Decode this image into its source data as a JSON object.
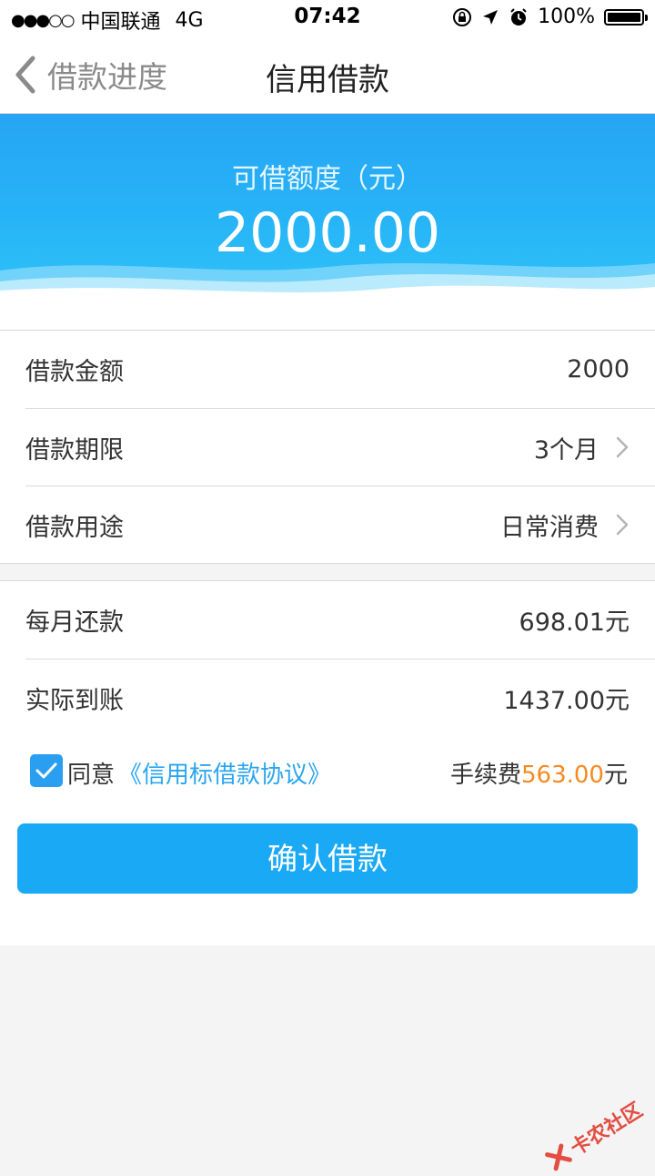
{
  "status_bar": {
    "signal": "●●●○○",
    "carrier": "中国联通",
    "network": "4G",
    "time": "07:42",
    "battery_percent": "100%",
    "icons": [
      "rotation-lock-icon",
      "location-arrow-icon",
      "alarm-icon",
      "battery-icon"
    ]
  },
  "nav": {
    "back_label": "借款进度",
    "title": "信用借款"
  },
  "banner": {
    "caption": "可借额度（元）",
    "amount": "2000.00",
    "color": "#27b4f7"
  },
  "loan_settings": [
    {
      "label": "借款金额",
      "value": "2000",
      "has_arrow": false
    },
    {
      "label": "借款期限",
      "value": "3个月",
      "has_arrow": true
    },
    {
      "label": "借款用途",
      "value": "日常消费",
      "has_arrow": true
    }
  ],
  "summary": [
    {
      "label": "每月还款",
      "value": "698.01元"
    },
    {
      "label": "实际到账",
      "value": "1437.00元"
    }
  ],
  "agreement": {
    "checked": true,
    "agree_text": "同意",
    "link_text": "《信用标借款协议》",
    "fee_label": "手续费",
    "fee_value": "563.00",
    "fee_unit": "元",
    "fee_color": "#f58a1f"
  },
  "confirm_button": {
    "label": "确认借款",
    "color": "#1aa9f5"
  },
  "watermark": {
    "text": "卡农社区"
  }
}
